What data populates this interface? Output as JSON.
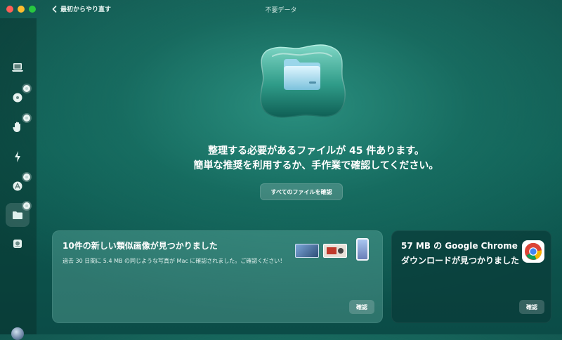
{
  "window": {
    "title": "不要データ",
    "back_label": "最初からやり直す"
  },
  "colors": {
    "close": "#ff5f57",
    "minimize": "#febc2e",
    "zoom": "#28c840"
  },
  "sidebar": {
    "items": [
      {
        "icon": "laptop-icon",
        "badge": false,
        "active": false
      },
      {
        "icon": "disk-icon",
        "badge": true,
        "active": false
      },
      {
        "icon": "hand-icon",
        "badge": true,
        "active": false
      },
      {
        "icon": "lightning-icon",
        "badge": false,
        "active": false
      },
      {
        "icon": "app-store-icon",
        "badge": true,
        "active": false
      },
      {
        "icon": "folder-icon",
        "badge": true,
        "active": true
      },
      {
        "icon": "drive-icon",
        "badge": false,
        "active": false
      }
    ]
  },
  "main": {
    "headline_line1": "整理する必要があるファイルが 45 件あります。",
    "headline_line2": "簡単な推奨を利用するか、手作業で確認してください。",
    "review_all_label": "すべてのファイルを確認"
  },
  "cards": {
    "similar_images": {
      "title": "10件の新しい類似画像が見つかりました",
      "description": "過去 30 日間に 5.4 MB の同じような写真が Mac に確認されました。ご確認ください！",
      "button_label": "確認"
    },
    "chrome_downloads": {
      "title": "57 MB の Google Chrome ダウンロードが見つかりました",
      "button_label": "確認"
    }
  }
}
